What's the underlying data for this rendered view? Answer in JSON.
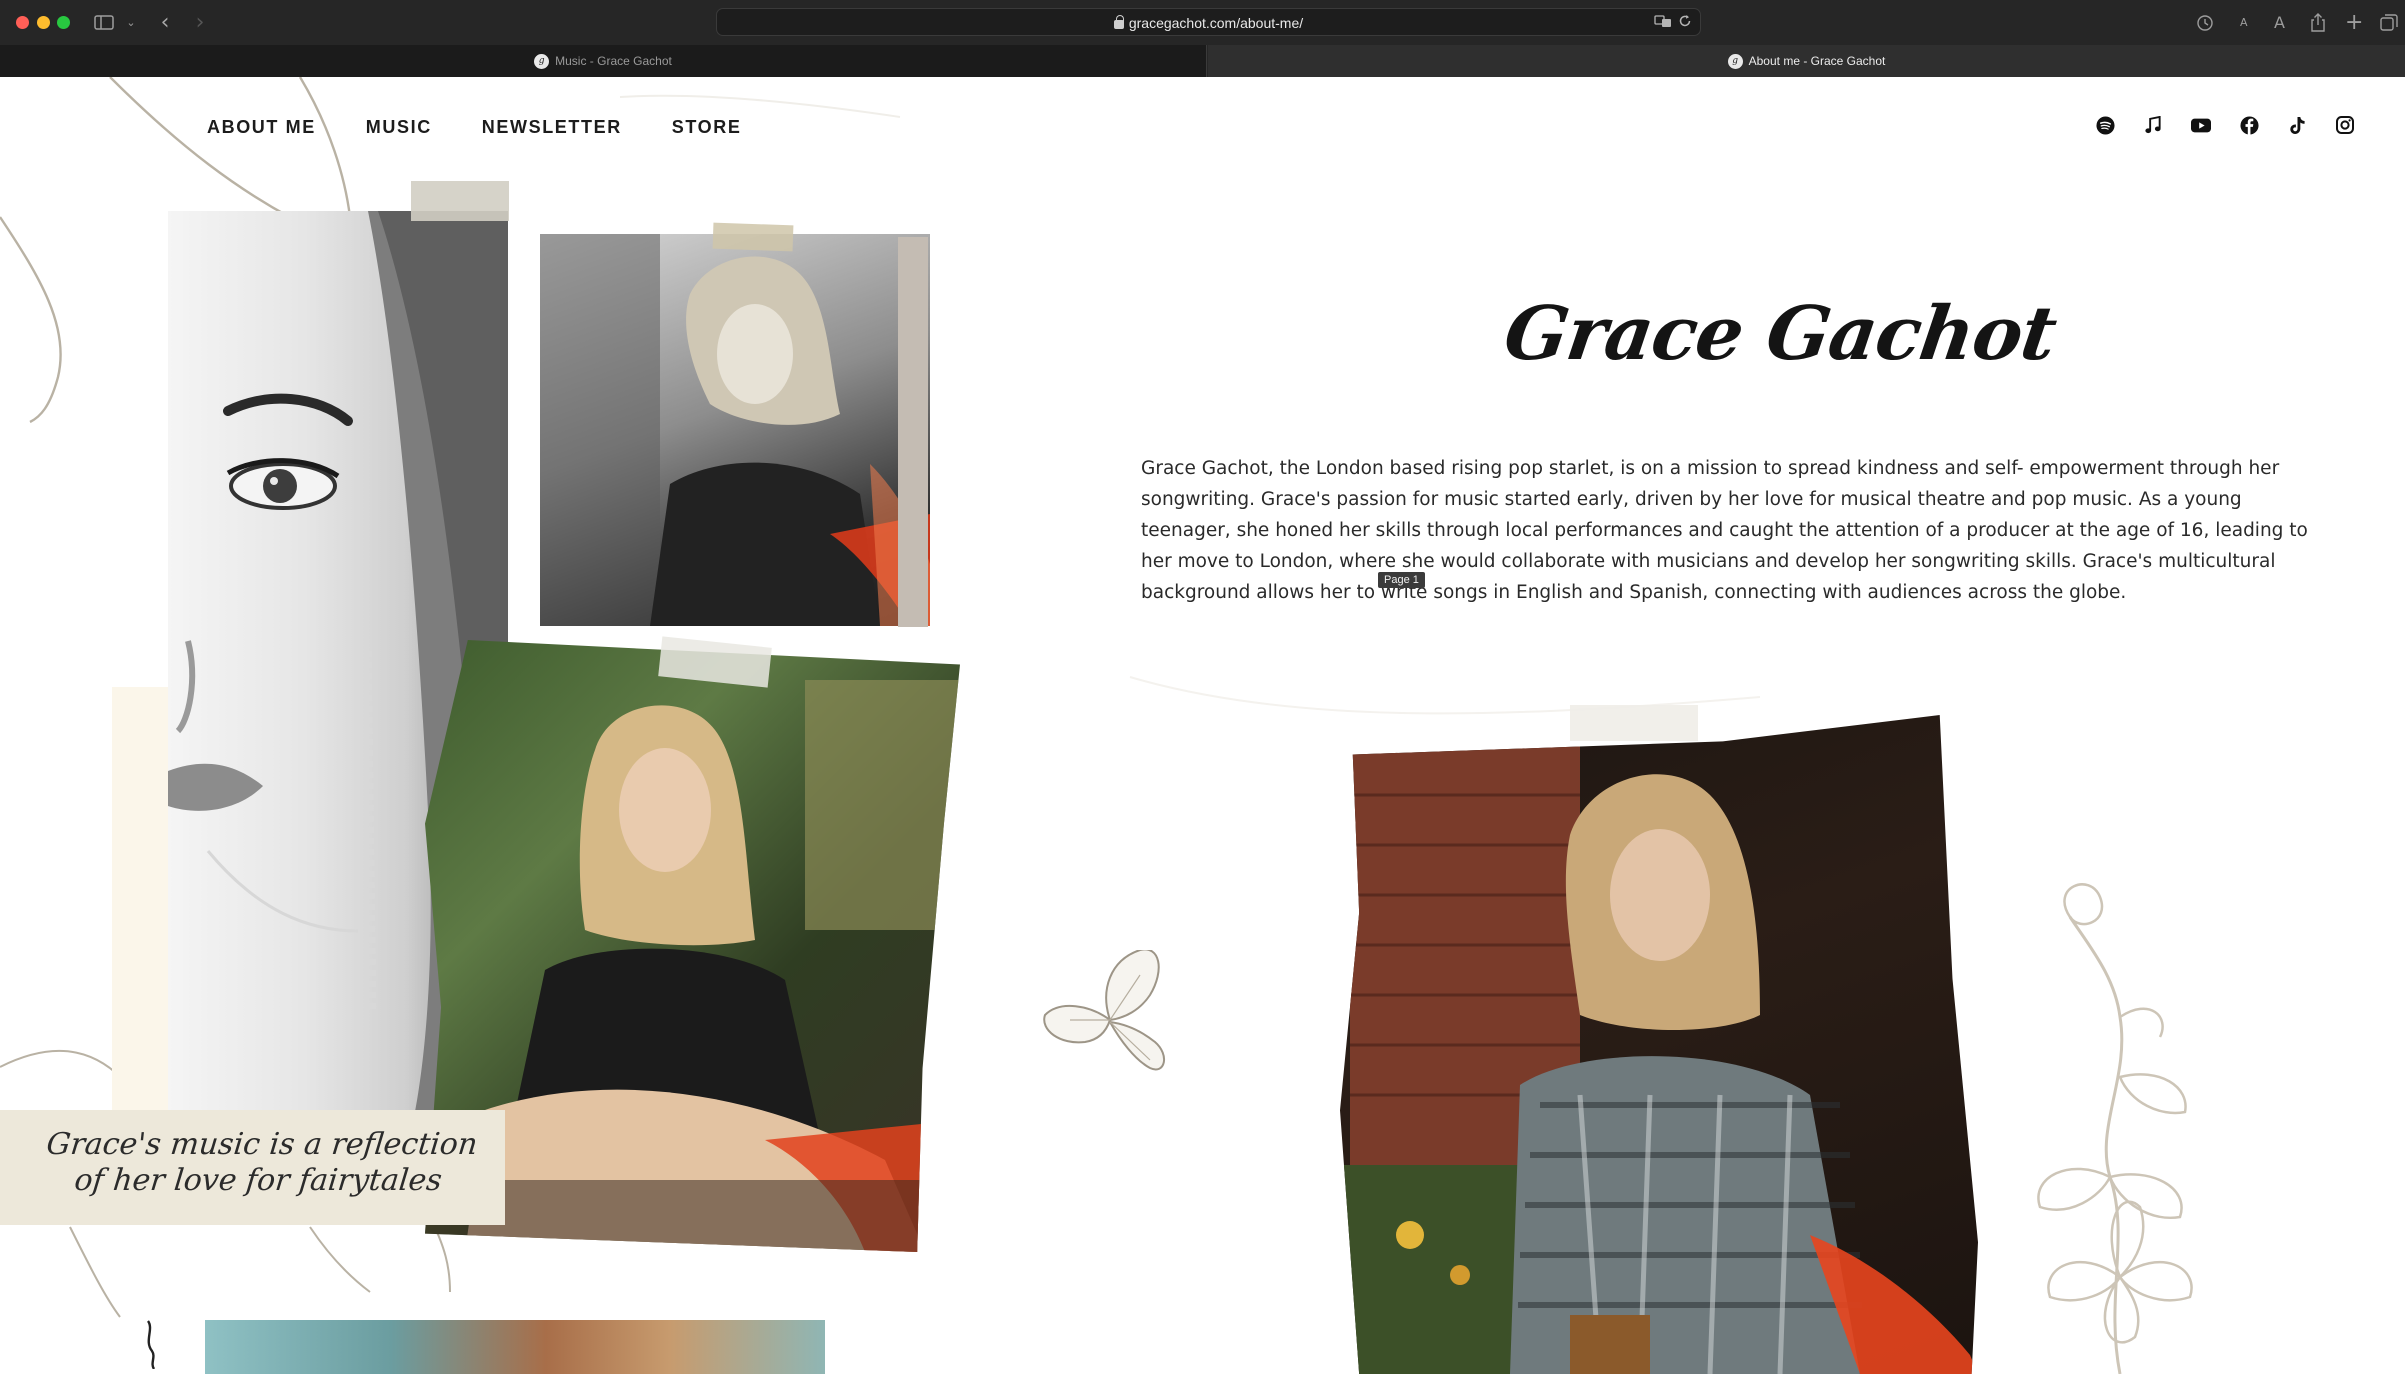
{
  "browser": {
    "url": "gracegachot.com/about-me/",
    "tabs": [
      {
        "title": "Music - Grace Gachot",
        "active": false
      },
      {
        "title": "About me - Grace Gachot",
        "active": true
      }
    ]
  },
  "nav": {
    "links": [
      "ABOUT ME",
      "MUSIC",
      "NEWSLETTER",
      "STORE"
    ]
  },
  "social": {
    "icons": [
      "spotify-icon",
      "music-note-icon",
      "youtube-icon",
      "facebook-icon",
      "tiktok-icon",
      "instagram-icon"
    ]
  },
  "hero": {
    "title": "Grace Gachot",
    "bio": "Grace Gachot, the London based rising pop starlet, is on a mission to spread kindness and self- empowerment through her songwriting. Grace's passion for music started early, driven by her love for musical theatre and pop music. As a young teenager, she honed her skills through local performances and caught the attention of a producer at the age of 16, leading to her move to London, where she would collaborate with musicians and develop her songwriting skills. Grace's multicultural background allows her to write songs in English and Spanish, connecting with audiences across the globe.",
    "tooltip": "Page 1"
  },
  "quote": {
    "line1": "Grace's music is a reflection",
    "line2": "of her love for fairytales"
  },
  "colors": {
    "chrome": "#262626",
    "paper": "#ede8da",
    "text": "#1c1c1c",
    "accent_red": "#e8451e"
  }
}
